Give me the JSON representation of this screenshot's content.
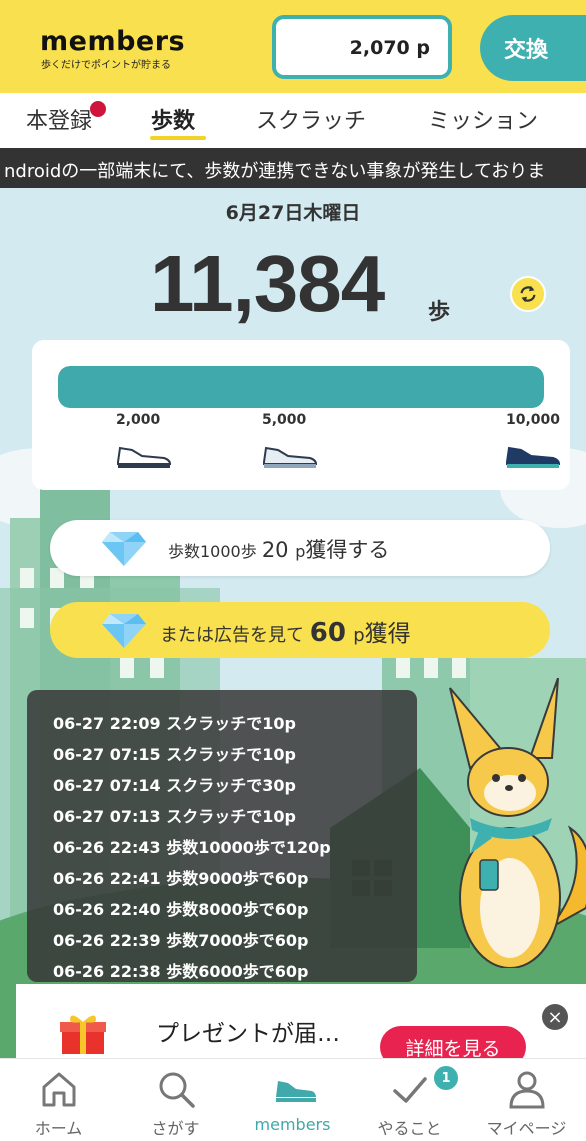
{
  "header": {
    "logo": "members",
    "tagline": "歩くだけでポイントが貯まる",
    "points": "2,070 p",
    "exchange_label": "交換"
  },
  "tabs": [
    {
      "label": "本登録",
      "has_notification": true
    },
    {
      "label": "歩数",
      "active": true
    },
    {
      "label": "スクラッチ"
    },
    {
      "label": "ミッション"
    }
  ],
  "ticker": "ndroidの一部端末にて、歩数が連携できない事象が発生しておりま",
  "steps": {
    "date": "6月27日木曜日",
    "count": "11,384",
    "unit": "歩",
    "milestones": [
      "2,000",
      "5,000",
      "10,000"
    ],
    "progress_fraction": 1.0
  },
  "earn": {
    "prefix": "歩数1000歩 ",
    "amount": "20",
    "unit": "p",
    "suffix": "獲得する"
  },
  "ad": {
    "prefix": "または広告を見て ",
    "amount": "60",
    "unit": "p",
    "suffix": "獲得"
  },
  "history": [
    "06-27 22:09 スクラッチで10p",
    "06-27 07:15 スクラッチで10p",
    "06-27 07:14 スクラッチで30p",
    "06-27 07:13 スクラッチで10p",
    "06-26 22:43 歩数10000歩で120p",
    "06-26 22:41 歩数9000歩で60p",
    "06-26 22:40 歩数8000歩で60p",
    "06-26 22:39 歩数7000歩で60p",
    "06-26 22:38 歩数6000歩で60p"
  ],
  "banner": {
    "text": "プレゼントが届…",
    "button": "詳細を見る",
    "close": "×"
  },
  "nav": [
    {
      "label": "ホーム",
      "icon": "home-icon"
    },
    {
      "label": "さがす",
      "icon": "search-icon"
    },
    {
      "label": "members",
      "icon": "shoe-icon",
      "active": true
    },
    {
      "label": "やること",
      "icon": "check-icon",
      "badge": "1"
    },
    {
      "label": "マイページ",
      "icon": "user-icon"
    }
  ],
  "colors": {
    "brand_yellow": "#f9e04e",
    "teal": "#3fa9ab",
    "alert_red": "#e8234f"
  }
}
